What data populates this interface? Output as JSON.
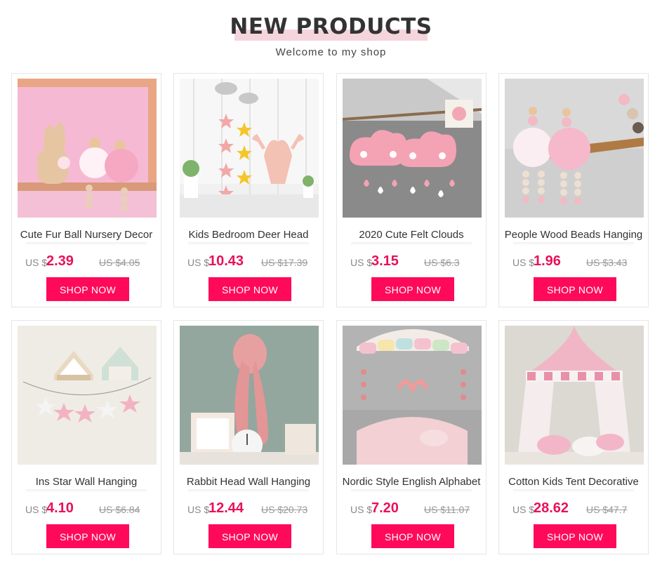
{
  "header": {
    "title": "NEW PRODUCTS",
    "subtitle": "Welcome to my shop"
  },
  "products": [
    {
      "name": "Cute Fur Ball Nursery Decor",
      "currency": "US $",
      "price": "2.39",
      "old_price": "US $4.05",
      "button": "SHOP NOW",
      "image": "bunny-shelf-photo"
    },
    {
      "name": "Kids Bedroom Deer Head",
      "currency": "US $",
      "price": "10.43",
      "old_price": "US $17.39",
      "button": "SHOP NOW",
      "image": "deer-head-stars-photo"
    },
    {
      "name": "2020 Cute Felt Clouds",
      "currency": "US $",
      "price": "3.15",
      "old_price": "US $6.3",
      "button": "SHOP NOW",
      "image": "felt-clouds-photo"
    },
    {
      "name": "People Wood Beads Hanging",
      "currency": "US $",
      "price": "1.96",
      "old_price": "US $3.43",
      "button": "SHOP NOW",
      "image": "wood-bead-dolls-photo"
    },
    {
      "name": "Ins Star Wall Hanging",
      "currency": "US $",
      "price": "4.10",
      "old_price": "US $6.84",
      "button": "SHOP NOW",
      "image": "star-garland-photo"
    },
    {
      "name": "Rabbit Head Wall Hanging",
      "currency": "US $",
      "price": "12.44",
      "old_price": "US $20.73",
      "button": "SHOP NOW",
      "image": "rabbit-head-photo"
    },
    {
      "name": "Nordic Style English Alphabet",
      "currency": "US $",
      "price": "7.20",
      "old_price": "US $11.07",
      "button": "SHOP NOW",
      "image": "love-letters-photo"
    },
    {
      "name": "Cotton Kids Tent Decorative",
      "currency": "US $",
      "price": "28.62",
      "old_price": "US $47.7",
      "button": "SHOP NOW",
      "image": "kids-tent-photo"
    }
  ],
  "colors": {
    "accent": "#ff0a5a",
    "price": "#e8115b",
    "title_bar": "#f5d5dc"
  }
}
